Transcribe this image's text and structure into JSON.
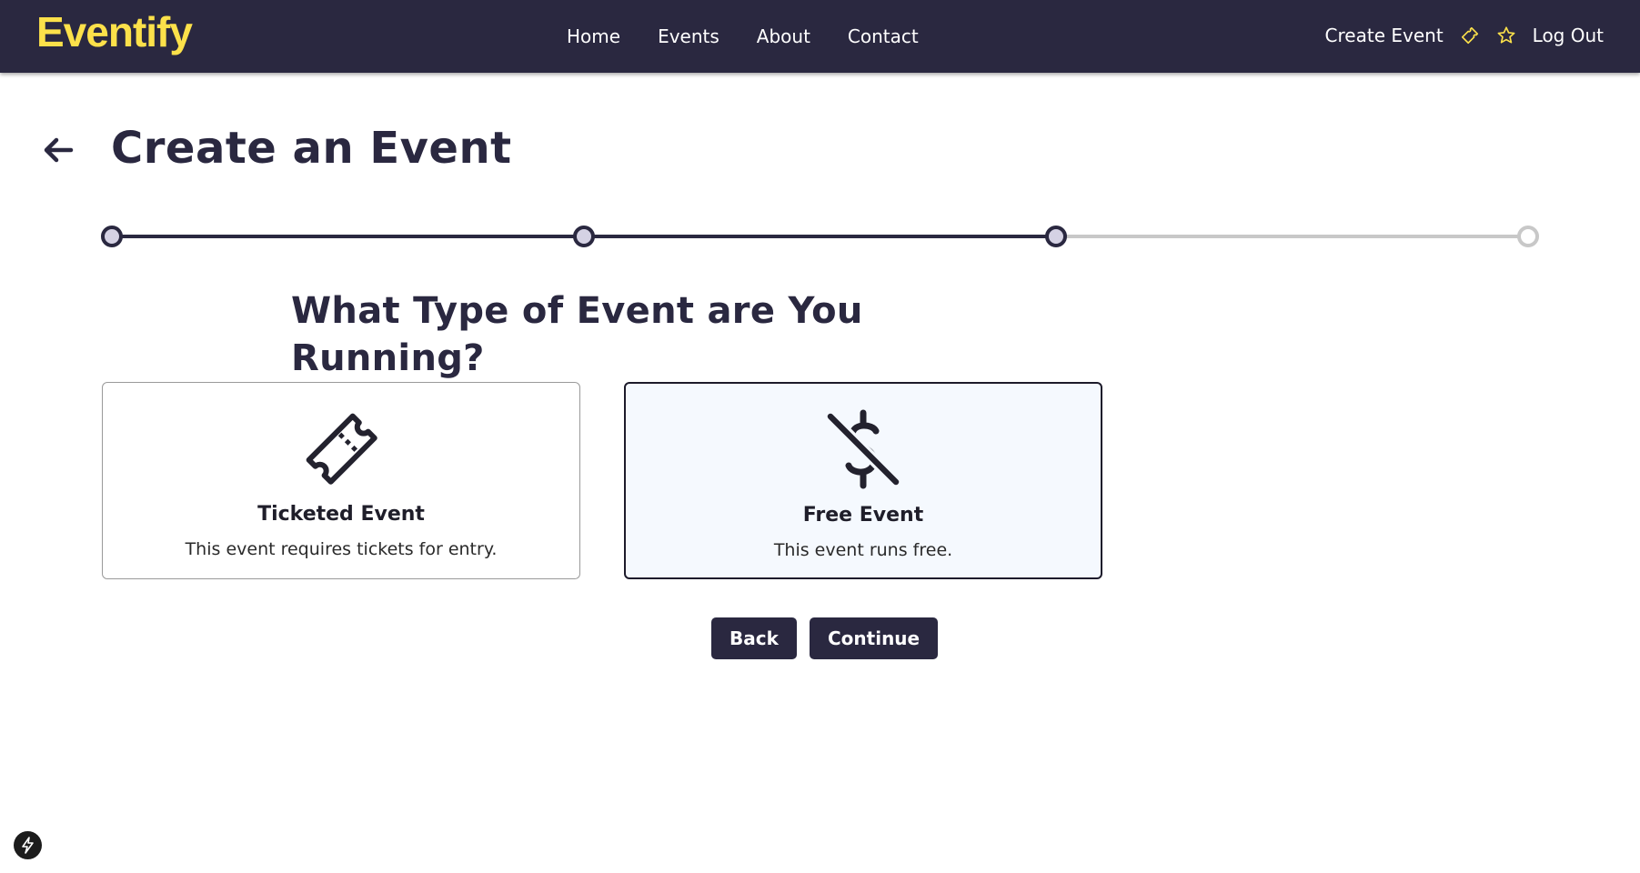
{
  "brand": {
    "name": "Eventify",
    "color": "#fce14a"
  },
  "nav": {
    "links": [
      "Home",
      "Events",
      "About",
      "Contact"
    ]
  },
  "header_right": {
    "create_event": "Create Event",
    "ticket_icon": "ticket-icon",
    "star_icon": "star-icon",
    "log_out": "Log Out"
  },
  "page": {
    "title": "Create an Event",
    "back_icon": "arrow-left-icon"
  },
  "stepper": {
    "total_steps": 4,
    "current_step": 3
  },
  "question": "What Type of Event are You Running?",
  "options": [
    {
      "title": "Ticketed Event",
      "description": "This event requires tickets for entry.",
      "icon": "ticket-icon",
      "selected": false
    },
    {
      "title": "Free Event",
      "description": "This event runs free.",
      "icon": "no-dollar-icon",
      "selected": true
    }
  ],
  "buttons": {
    "back": "Back",
    "continue": "Continue"
  },
  "colors": {
    "primary": "#2a2840",
    "accent": "#fce14a",
    "selected_bg": "#f5f9fe",
    "inactive": "#c8c8c8"
  }
}
